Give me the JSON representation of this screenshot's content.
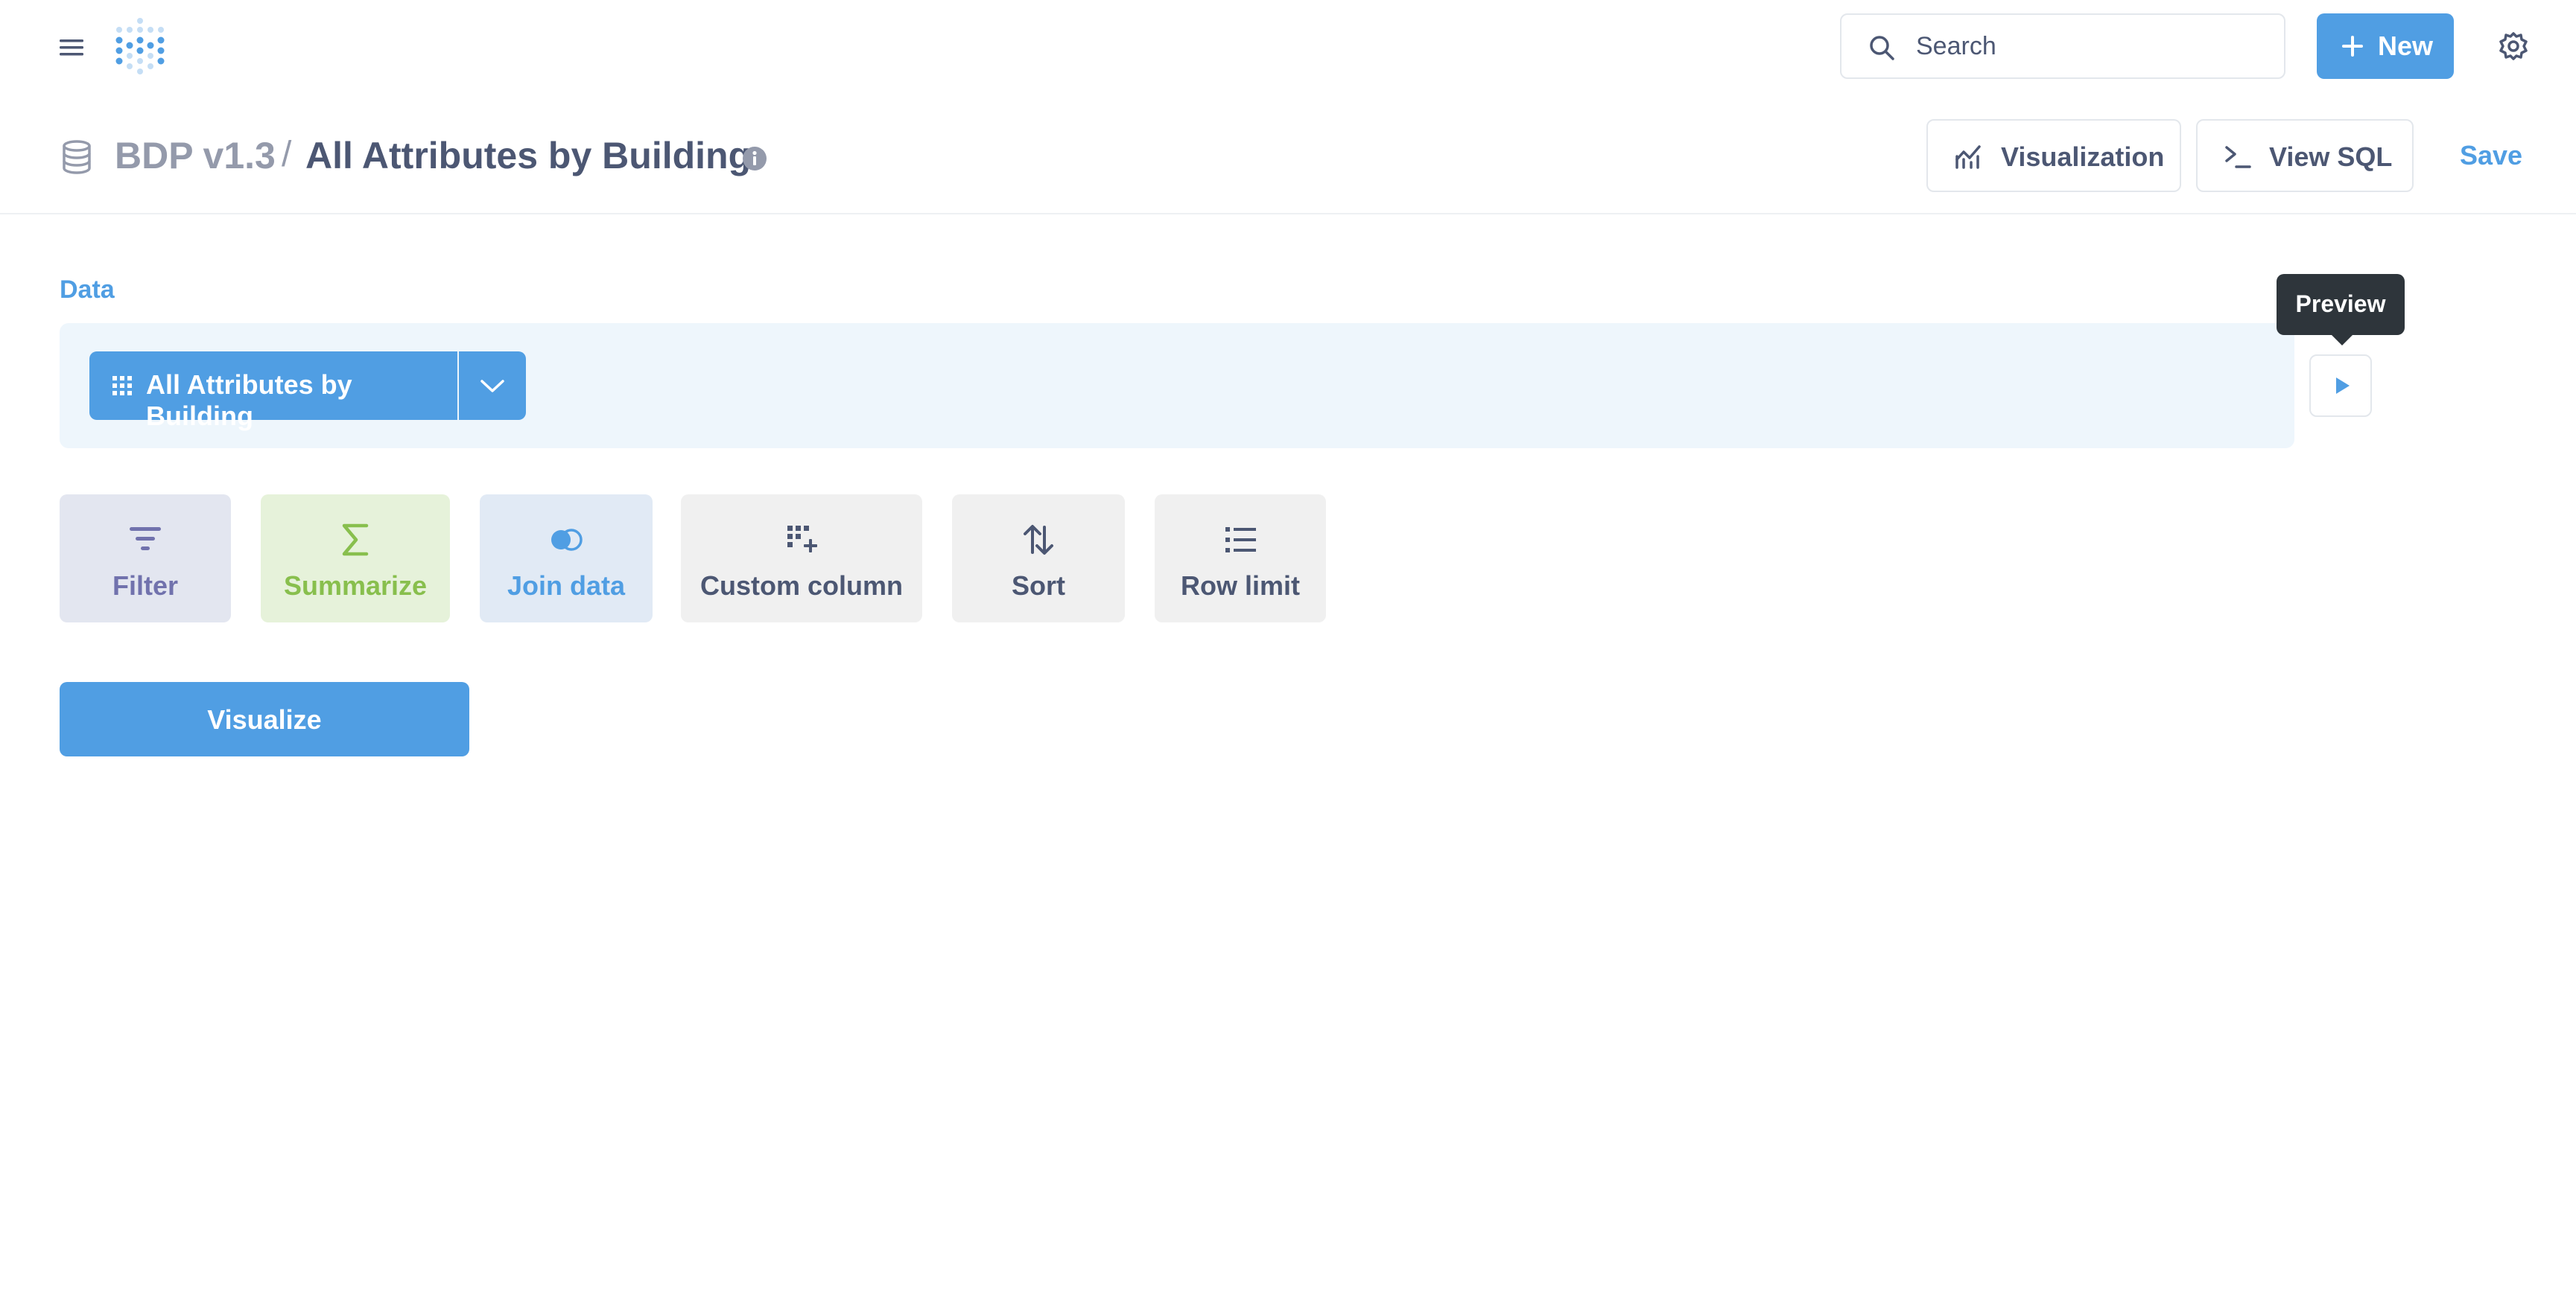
{
  "nav": {
    "search_label": "Search",
    "new_label": "New"
  },
  "header": {
    "database": "BDP v1.3",
    "separator": "/",
    "title": "All Attributes by Building",
    "visualization_label": "Visualization",
    "view_sql_label": "View SQL",
    "save_label": "Save"
  },
  "data_section": {
    "label": "Data",
    "table_name": "All Attributes by Building",
    "preview_tooltip": "Preview"
  },
  "steps": {
    "filter": "Filter",
    "summarize": "Summarize",
    "join": "Join data",
    "custom_column": "Custom column",
    "sort": "Sort",
    "row_limit": "Row limit"
  },
  "visualize_label": "Visualize",
  "colors": {
    "brand": "#509ee3",
    "filter": "#7172ad",
    "summarize": "#88bf4d",
    "text_dark": "#4c5773",
    "text_light": "#949aab"
  },
  "icons": [
    "hamburger-menu-icon",
    "metabase-logo-icon",
    "search-icon",
    "plus-icon",
    "gear-icon",
    "database-icon",
    "info-icon",
    "line-chart-icon",
    "terminal-icon",
    "grid-icon",
    "chevron-down-icon",
    "play-icon",
    "filter-icon",
    "sigma-icon",
    "join-icon",
    "custom-column-icon",
    "sort-icon",
    "list-icon"
  ]
}
